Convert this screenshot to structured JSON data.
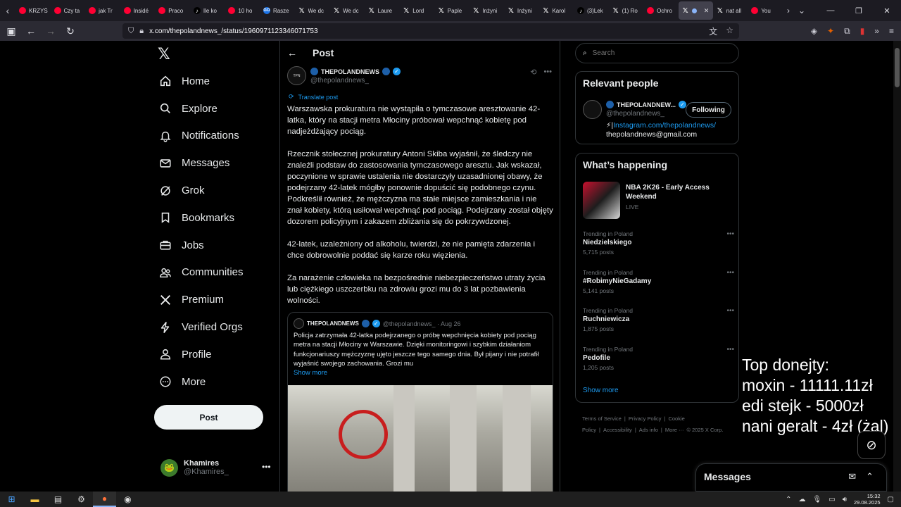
{
  "browser": {
    "tabs": [
      {
        "icon": "youtube-icon",
        "label": "KRZYŚ"
      },
      {
        "icon": "youtube-icon",
        "label": "Czy ta"
      },
      {
        "icon": "youtube-icon",
        "label": "jak Tr"
      },
      {
        "icon": "youtube-icon",
        "label": "Insidé"
      },
      {
        "icon": "youtube-icon",
        "label": "Praco"
      },
      {
        "icon": "tiktok-icon",
        "label": "Ile ko"
      },
      {
        "icon": "youtube-icon",
        "label": "10 ho"
      },
      {
        "icon": "go-icon",
        "label": "Rasze"
      },
      {
        "icon": "x-icon",
        "label": "We dc"
      },
      {
        "icon": "x-icon",
        "label": "We dc"
      },
      {
        "icon": "x-icon",
        "label": "Laure"
      },
      {
        "icon": "x-icon",
        "label": "Lord"
      },
      {
        "icon": "x-icon",
        "label": "Paple"
      },
      {
        "icon": "x-icon",
        "label": "Inżyni"
      },
      {
        "icon": "x-icon",
        "label": "Inżyni"
      },
      {
        "icon": "x-icon",
        "label": "Karol"
      },
      {
        "icon": "tiktok-icon",
        "label": "(3)Lek"
      },
      {
        "icon": "x-icon",
        "label": "(1) Ro"
      },
      {
        "icon": "youtube-icon",
        "label": "Ochro"
      },
      {
        "icon": "x-icon",
        "label": "",
        "active": true
      },
      {
        "icon": "x-icon",
        "label": "nat all"
      },
      {
        "icon": "youtube-icon",
        "label": "You"
      }
    ],
    "url": "x.com/thepolandnews_/status/1960971123346071753"
  },
  "sidebar": {
    "items": [
      {
        "icon": "home-icon",
        "label": "Home"
      },
      {
        "icon": "search-icon",
        "label": "Explore"
      },
      {
        "icon": "bell-icon",
        "label": "Notifications"
      },
      {
        "icon": "mail-icon",
        "label": "Messages"
      },
      {
        "icon": "grok-icon",
        "label": "Grok"
      },
      {
        "icon": "bookmark-icon",
        "label": "Bookmarks"
      },
      {
        "icon": "briefcase-icon",
        "label": "Jobs"
      },
      {
        "icon": "people-icon",
        "label": "Communities"
      },
      {
        "icon": "x-logo-icon",
        "label": "Premium"
      },
      {
        "icon": "lightning-icon",
        "label": "Verified Orgs"
      },
      {
        "icon": "person-icon",
        "label": "Profile"
      },
      {
        "icon": "more-circle-icon",
        "label": "More"
      }
    ],
    "post_button": "Post",
    "account": {
      "name": "Khamires",
      "handle": "@Khamires_"
    }
  },
  "post": {
    "header_title": "Post",
    "author_name": "THEPOLANDNEWS",
    "author_handle": "@thepolandnews_",
    "avatar_text": "TPN",
    "translate_label": "Translate post",
    "paragraphs": [
      "Warszawska prokuratura nie wystąpiła o tymczasowe aresztowanie 42-latka, który na stacji metra Młociny próbował wepchnąć kobietę pod nadjeżdżający pociąg.",
      "Rzecznik stołecznej prokuratury Antoni Skiba wyjaśnił, że śledczy nie znaleźli podstaw do zastosowania tymczasowego aresztu. Jak wskazał, poczynione w sprawie ustalenia nie dostarczyły uzasadnionej obawy, że podejrzany 42-latek mógłby ponownie dopuścić się podobnego czynu. Podkreślił również, że mężczyzna ma stałe miejsce zamieszkania i nie znał kobiety, którą usiłował wepchnąć pod pociąg. Podejrzany został objęty dozorem policyjnym i zakazem zbliżania się do pokrzywdzonej.",
      "42-latek, uzależniony od alkoholu, twierdzi, że nie pamięta zdarzenia i chce dobrowolnie poddać się karze roku więzienia.",
      "Za narażenie człowieka na bezpośrednie niebezpieczeństwo utraty życia lub ciężkiego uszczerbku na zdrowiu grozi mu do 3 lat pozbawienia wolności."
    ],
    "quote": {
      "author_name": "THEPOLANDNEWS",
      "author_handle": "@thepolandnews_ · Aug 26",
      "text": "Policja zatrzymała 42-latka podejrzanego o próbę wepchnięcia kobiety pod pociąg metra na stacji Młociny w Warszawie. Dzięki monitoringowi i szybkim działaniom funkcjonariuszy mężczyznę ujęto jeszcze tego samego dnia. Był pijany i nie potrafił wyjaśnić swojego zachowania. Grozi mu",
      "show_more": "Show more"
    }
  },
  "right": {
    "search_placeholder": "Search",
    "relevant_title": "Relevant people",
    "person": {
      "name": "THEPOLANDNEW...",
      "handle": "@thepolandnews_",
      "follow_label": "Following",
      "bio_prefix": "⚡|",
      "bio_link": "Instagram.com/thepolandnews/",
      "bio_email": "thepolandnews@gmail.com"
    },
    "happening_title": "What’s happening",
    "featured": {
      "title": "NBA 2K26 - Early Access Weekend",
      "status": "LIVE"
    },
    "trends": [
      {
        "context": "Trending in Poland",
        "name": "Niedzielskiego",
        "count": "5,715 posts"
      },
      {
        "context": "Trending in Poland",
        "name": "#RobimyNieGadamy",
        "count": "5,141 posts"
      },
      {
        "context": "Trending in Poland",
        "name": "Ruchniewicza",
        "count": "1,875 posts"
      },
      {
        "context": "Trending in Poland",
        "name": "Pedofile",
        "count": "1,205 posts"
      }
    ],
    "show_more": "Show more",
    "footer": [
      "Terms of Service",
      "|",
      "Privacy Policy",
      "|",
      "Cookie Policy",
      "|",
      "Accessibility",
      "|",
      "Ads info",
      "|",
      "More ···",
      "© 2025 X Corp."
    ]
  },
  "overlay": {
    "lines": [
      "Top donejty:",
      "moxin - 11111.11zł",
      "edi stejk - 5000zł",
      "nani geralt - 4zł (żal)"
    ]
  },
  "messages_drawer": {
    "title": "Messages"
  },
  "taskbar": {
    "time": "15:32",
    "date": "29.08.2025"
  },
  "colors": {
    "accent": "#1d9bf0",
    "background": "#000000",
    "border": "#2f3336",
    "muted": "#71767b"
  }
}
